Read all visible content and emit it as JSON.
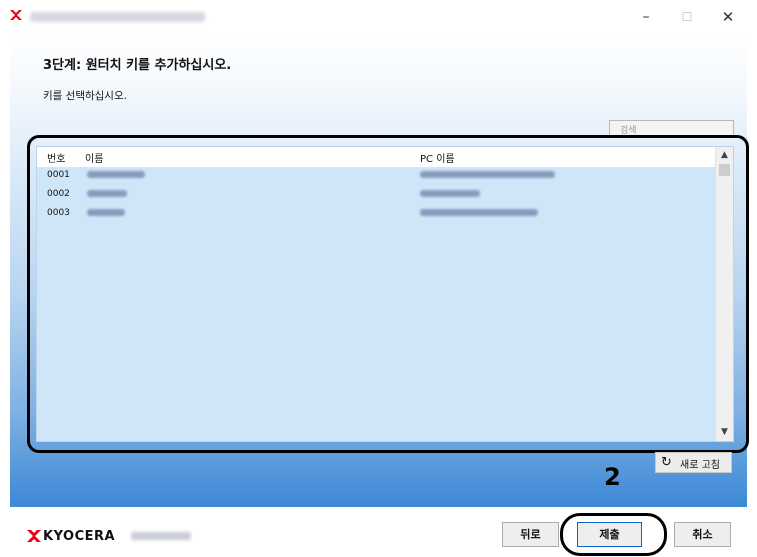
{
  "window": {
    "controls": {
      "minimize": "–",
      "maximize": "☐",
      "close": "✕"
    }
  },
  "page": {
    "title": "3단계: 원터치 키를 추가하십시오.",
    "subtitle": "키를 선택하십시오."
  },
  "search": {
    "placeholder": "검색"
  },
  "list": {
    "columns": [
      "번호",
      "이름",
      "PC 이름"
    ],
    "rows": [
      {
        "number": "0001"
      },
      {
        "number": "0002"
      },
      {
        "number": "0003"
      }
    ]
  },
  "refresh": {
    "label": "새로 고침"
  },
  "annotation": {
    "step": "2"
  },
  "footer": {
    "brand": "KYOCERA",
    "back_label": "뒤로",
    "submit_label": "제출",
    "cancel_label": "취소"
  },
  "colors": {
    "brand_red": "#e60012",
    "accent_blue": "#0a64c8"
  },
  "icons": [
    "kyocera-logo-icon",
    "refresh-icon",
    "scroll-up-icon",
    "scroll-down-icon"
  ]
}
